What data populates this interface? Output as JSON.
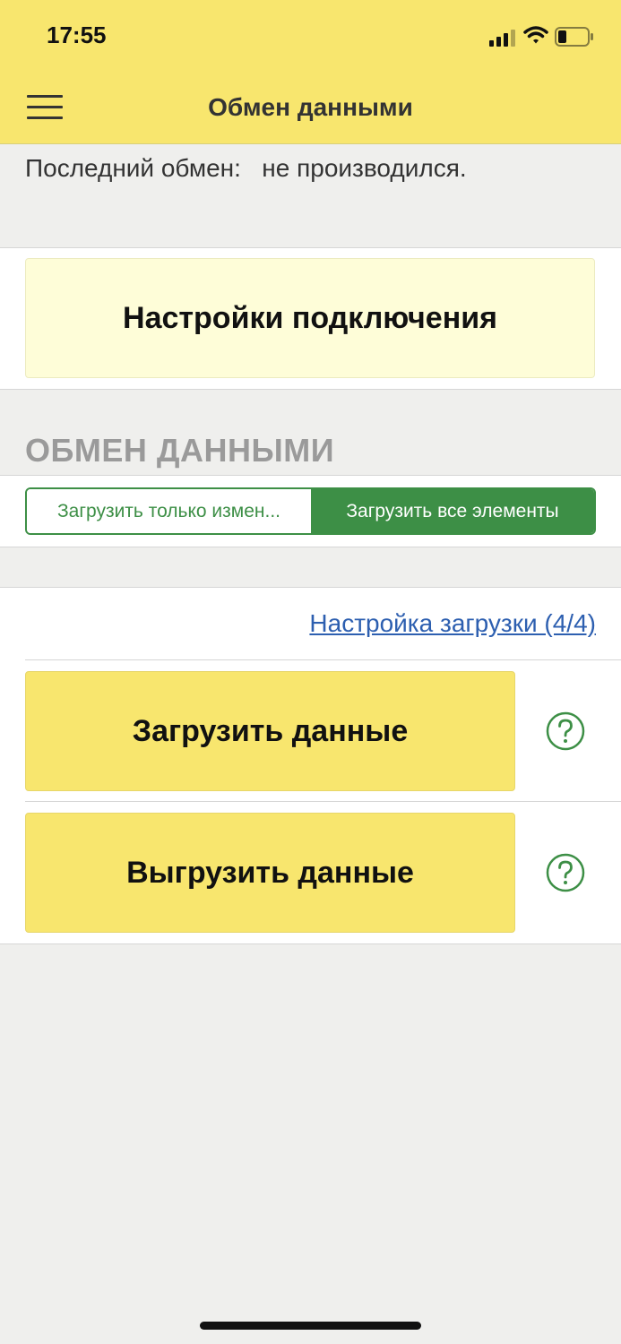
{
  "status_bar": {
    "time": "17:55",
    "icons": [
      "cellular-signal-icon",
      "wifi-icon",
      "battery-icon"
    ]
  },
  "header": {
    "title": "Обмен данными",
    "menu_icon": "hamburger-menu-icon"
  },
  "last_exchange": {
    "label": "Последний обмен:",
    "value": "не производился."
  },
  "connection": {
    "button_label": "Настройки подключения"
  },
  "exchange_section": {
    "title": "ОБМЕН ДАННЫМИ",
    "toggle": {
      "options": [
        "Загрузить только измен...",
        "Загрузить все элементы"
      ],
      "selected": "Загрузить все элементы"
    }
  },
  "actions": {
    "settings_link": "Настройка загрузки (4/4)",
    "download_label": "Загрузить данные",
    "upload_label": "Выгрузить данные",
    "help_icon": "question-circle-icon"
  },
  "colors": {
    "header_bg": "#f8e66e",
    "page_bg": "#efefed",
    "accent_green": "#3d8f46",
    "link_blue": "#2d5fb0",
    "connection_button_bg": "#fefdd8",
    "action_button_bg": "#f8e66e"
  }
}
